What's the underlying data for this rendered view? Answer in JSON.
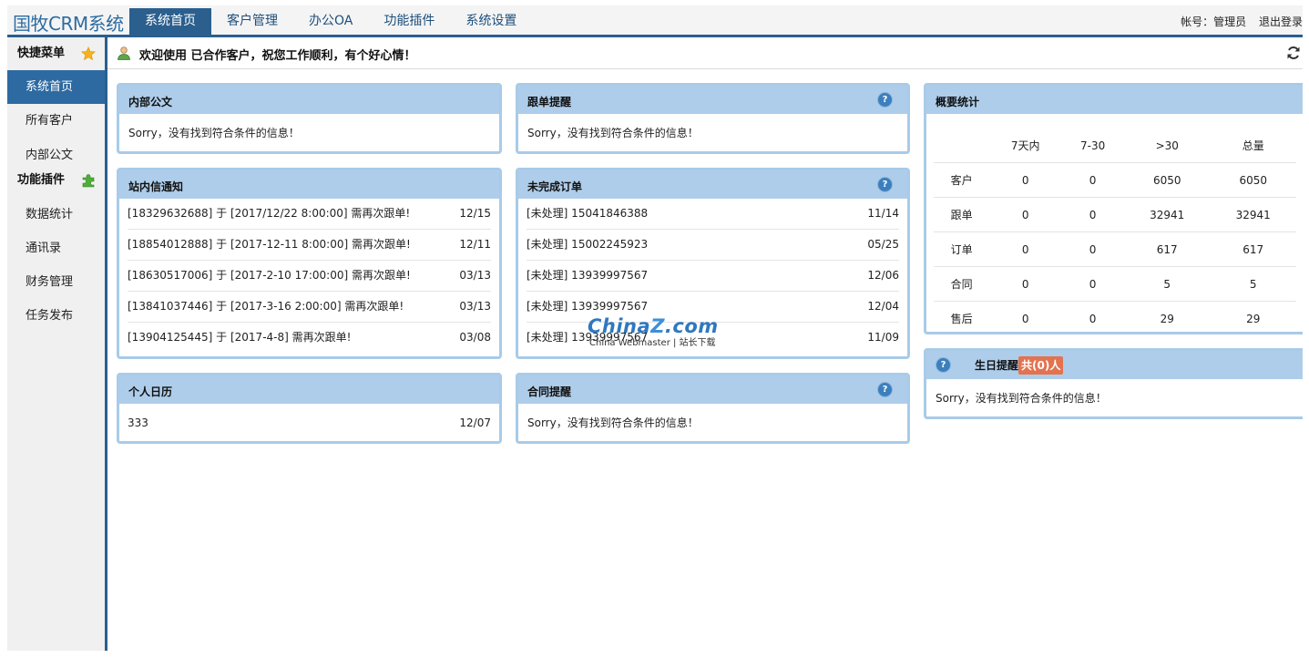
{
  "app": {
    "title": "国牧CRM系统"
  },
  "nav": {
    "items": [
      {
        "label": "系统首页",
        "active": true
      },
      {
        "label": "客户管理"
      },
      {
        "label": "办公OA"
      },
      {
        "label": "功能插件"
      },
      {
        "label": "系统设置"
      }
    ]
  },
  "user": {
    "account": "帐号：管理员",
    "logout": "退出登录"
  },
  "sidebar": {
    "quick_menu_title": "快捷菜单",
    "quick_items": [
      "系统首页",
      "所有客户",
      "内部公文"
    ],
    "plugin_title": "功能插件",
    "plugin_items": [
      "数据统计",
      "通讯录",
      "财务管理",
      "任务发布"
    ]
  },
  "welcome": {
    "text": "欢迎使用 已合作客户，祝您工作顺利，有个好心情！"
  },
  "panels": {
    "internal_doc": {
      "title": "内部公文",
      "empty": "Sorry，没有找到符合条件的信息！"
    },
    "followup_remind": {
      "title": "跟单提醒",
      "empty": "Sorry，没有找到符合条件的信息！"
    },
    "site_messages": {
      "title": "站内信通知",
      "rows": [
        {
          "text": "[18329632688] 于 [2017/12/22 8:00:00] 需再次跟单!",
          "date": "12/15"
        },
        {
          "text": "[18854012888] 于 [2017-12-11 8:00:00] 需再次跟单!",
          "date": "12/11"
        },
        {
          "text": "[18630517006] 于 [2017-2-10 17:00:00] 需再次跟单!",
          "date": "03/13"
        },
        {
          "text": "[13841037446] 于 [2017-3-16 2:00:00] 需再次跟单!",
          "date": "03/13"
        },
        {
          "text": "[13904125445] 于 [2017-4-8] 需再次跟单!",
          "date": "03/08"
        }
      ]
    },
    "pending_orders": {
      "title": "未完成订单",
      "rows": [
        {
          "text": "[未处理] 15041846388",
          "date": "11/14"
        },
        {
          "text": "[未处理] 15002245923",
          "date": "05/25"
        },
        {
          "text": "[未处理] 13939997567",
          "date": "12/06"
        },
        {
          "text": "[未处理] 13939997567",
          "date": "12/04"
        },
        {
          "text": "[未处理] 13939997567",
          "date": "11/09"
        }
      ]
    },
    "calendar": {
      "title": "个人日历",
      "rows": [
        {
          "text": "333",
          "date": "12/07"
        }
      ]
    },
    "contract_remind": {
      "title": "合同提醒",
      "empty": "Sorry，没有找到符合条件的信息！"
    },
    "summary": {
      "title": "概要统计",
      "columns": [
        "",
        "7天内",
        "7-30",
        ">30",
        "总量"
      ],
      "rows": [
        {
          "label": "客户",
          "values": [
            "0",
            "0",
            "6050",
            "6050"
          ]
        },
        {
          "label": "跟单",
          "values": [
            "0",
            "0",
            "32941",
            "32941"
          ]
        },
        {
          "label": "订单",
          "values": [
            "0",
            "0",
            "617",
            "617"
          ]
        },
        {
          "label": "合同",
          "values": [
            "0",
            "0",
            "5",
            "5"
          ]
        },
        {
          "label": "售后",
          "values": [
            "0",
            "0",
            "29",
            "29"
          ]
        }
      ]
    },
    "birthday": {
      "title": "生日提醒",
      "badge": "共(0)人",
      "empty": "Sorry，没有找到符合条件的信息！"
    }
  },
  "watermark": {
    "logo_main": "China",
    "logo_z": "Z",
    "logo_tail": ".com",
    "sub": "China Webmaster | 站长下载"
  },
  "colors": {
    "nav_active": "#2b5f8e",
    "panel_head": "#aecdea",
    "panel_border": "#a8cbe9",
    "badge": "#e3734f",
    "help_icon": "#3c7fbe"
  }
}
